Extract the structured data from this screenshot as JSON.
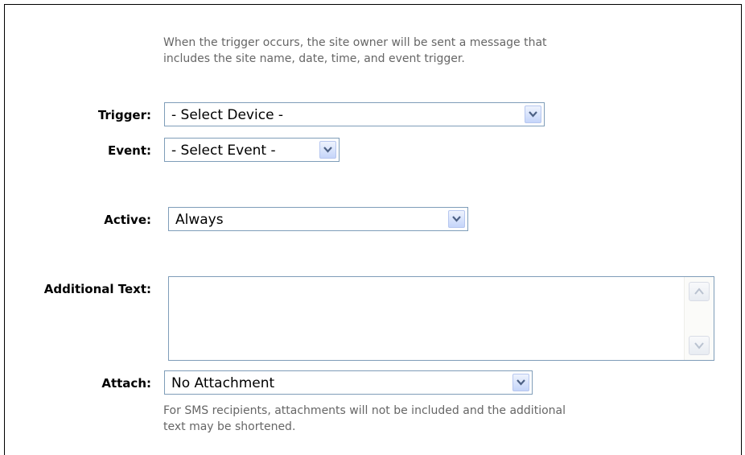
{
  "intro": {
    "line1": "When the trigger occurs, the site owner will be sent a message that",
    "line2": "includes the site name, date, time, and event trigger."
  },
  "trigger": {
    "label": "Trigger:",
    "value": "- Select Device -"
  },
  "event": {
    "label": "Event:",
    "value": "- Select Event -"
  },
  "active": {
    "label": "Active:",
    "value": "Always"
  },
  "additional_text": {
    "label": "Additional Text:",
    "value": ""
  },
  "attach": {
    "label": "Attach:",
    "value": "No Attachment"
  },
  "sms_note": {
    "line1": "For SMS recipients, attachments will not be included and the additional",
    "line2": "text may be shortened."
  },
  "colors": {
    "border": "#7f9db9",
    "arrow_glyph": "#4d6185",
    "info_text": "#666666"
  }
}
